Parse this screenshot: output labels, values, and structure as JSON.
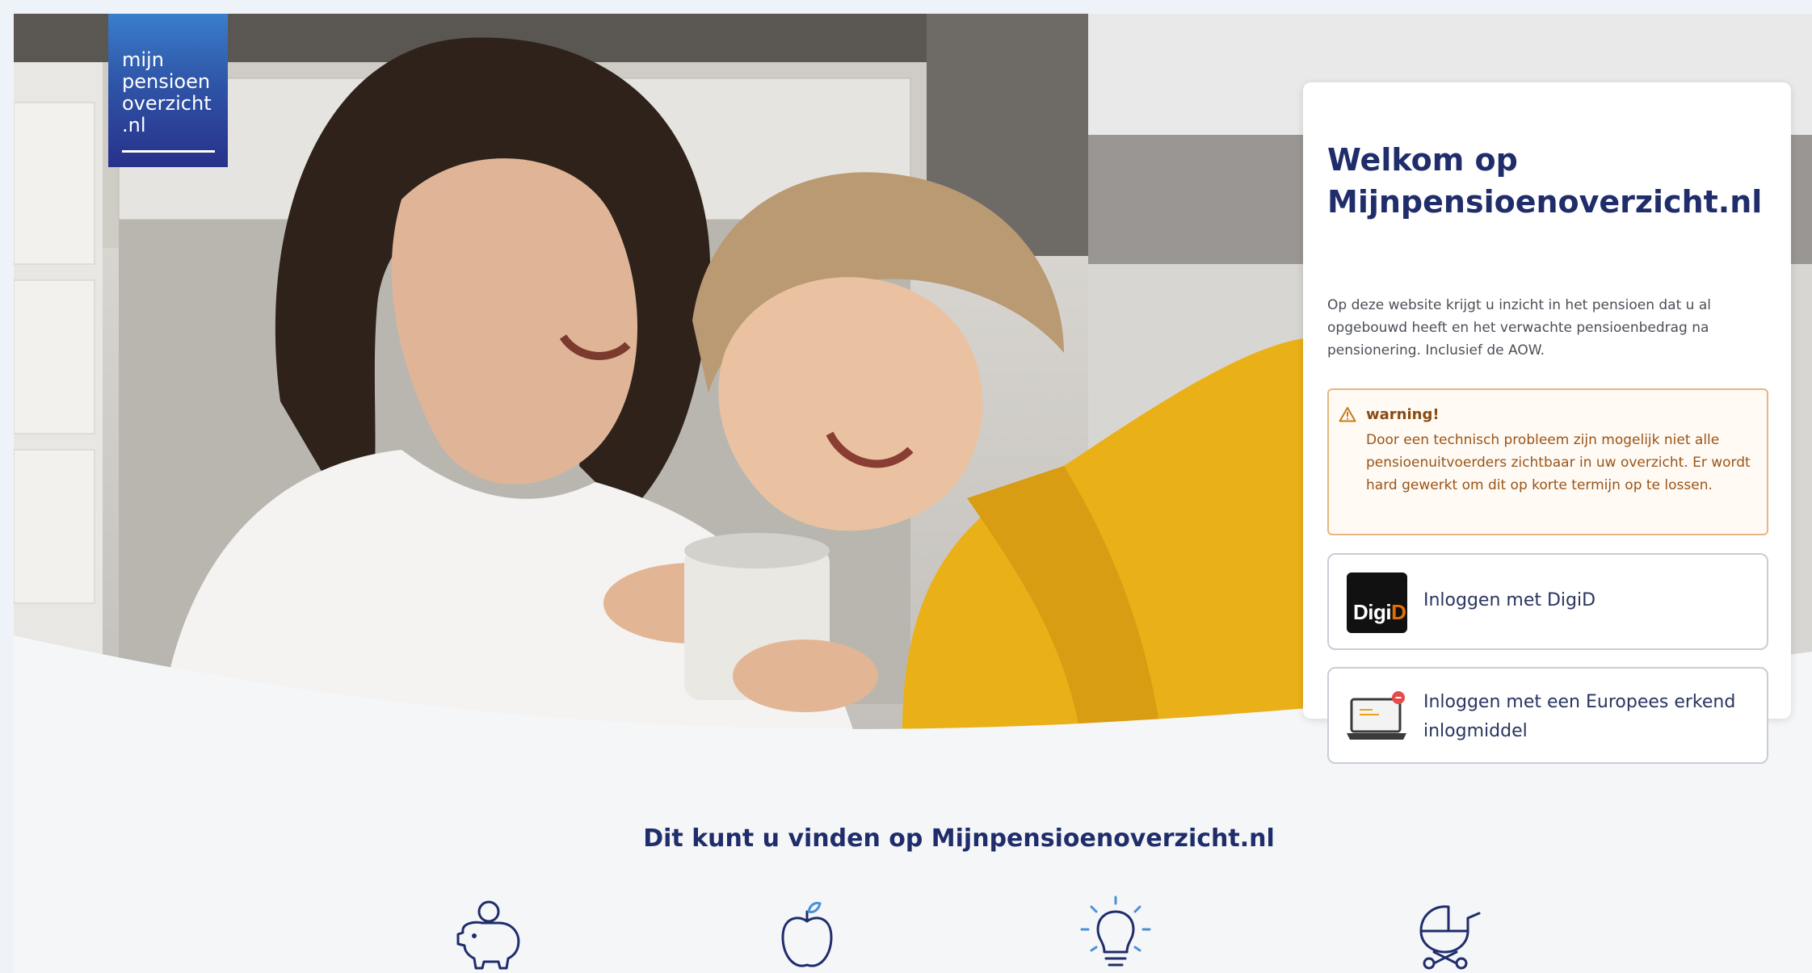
{
  "logo": {
    "lines": [
      "mijn",
      "pensioen",
      "overzicht",
      ".nl"
    ]
  },
  "card": {
    "title": "Welkom op Mijnpensioenoverzicht.nl",
    "intro": "Op deze website krijgt u inzicht in het pensioen dat u al opgebouwd heeft en het verwachte pensioenbedrag na pensionering. Inclusief de AOW.",
    "warning": {
      "title": "warning!",
      "text": "Door een technisch probleem zijn mogelijk niet alle pensioenuitvoerders zichtbaar in uw overzicht. Er wordt hard gewerkt om dit op korte termijn op te lossen."
    },
    "digid_button": {
      "logo_text_1": "Digi",
      "logo_text_2": "D",
      "label": "Inloggen met DigiD"
    },
    "eu_button": {
      "label": "Inloggen met een Europees erkend inlogmiddel"
    }
  },
  "features": {
    "title": "Dit kunt u vinden op Mijnpensioenoverzicht.nl",
    "icons": [
      "piggy-bank-icon",
      "apple-icon",
      "lightbulb-icon",
      "baby-carriage-icon"
    ]
  },
  "colors": {
    "brand_dark": "#1f2d6b",
    "warning_border": "#e3b77e",
    "warning_text": "#9a5417",
    "digid_orange": "#e17000"
  }
}
